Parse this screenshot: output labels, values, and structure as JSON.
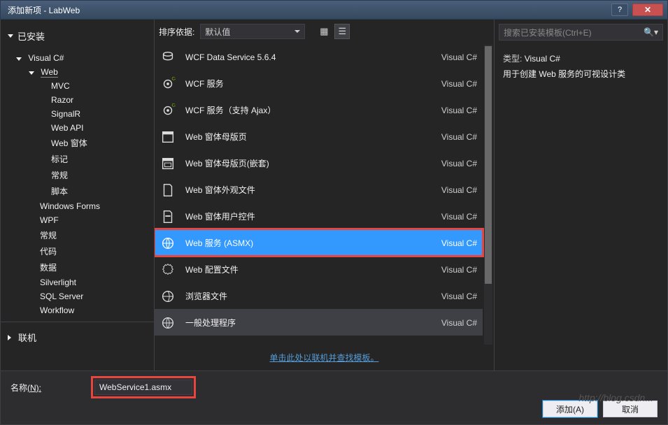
{
  "window": {
    "title": "添加新项 - LabWeb"
  },
  "sidebar": {
    "installed": "已安装",
    "online": "联机",
    "nodes": [
      {
        "label": "Visual C#",
        "level": 1,
        "expanded": true
      },
      {
        "label": "Web",
        "level": 2,
        "expanded": true,
        "selected": true
      },
      {
        "label": "MVC",
        "level": 3
      },
      {
        "label": "Razor",
        "level": 3
      },
      {
        "label": "SignalR",
        "level": 3
      },
      {
        "label": "Web API",
        "level": 3
      },
      {
        "label": "Web 窗体",
        "level": 3
      },
      {
        "label": "标记",
        "level": 3
      },
      {
        "label": "常规",
        "level": 3
      },
      {
        "label": "脚本",
        "level": 3
      },
      {
        "label": "Windows Forms",
        "level": "2b"
      },
      {
        "label": "WPF",
        "level": "2b"
      },
      {
        "label": "常规",
        "level": "2b"
      },
      {
        "label": "代码",
        "level": "2b"
      },
      {
        "label": "数据",
        "level": "2b"
      },
      {
        "label": "Silverlight",
        "level": "2b"
      },
      {
        "label": "SQL Server",
        "level": "2b"
      },
      {
        "label": "Workflow",
        "level": "2b"
      }
    ]
  },
  "toolbar": {
    "sort_label": "排序依据:",
    "sort_value": "默认值"
  },
  "search": {
    "placeholder": "搜索已安装模板(Ctrl+E)"
  },
  "items": [
    {
      "name": "WCF Data Service 5.6.4",
      "lang": "Visual C#"
    },
    {
      "name": "WCF 服务",
      "lang": "Visual C#"
    },
    {
      "name": "WCF 服务（支持 Ajax）",
      "lang": "Visual C#"
    },
    {
      "name": "Web 窗体母版页",
      "lang": "Visual C#"
    },
    {
      "name": "Web 窗体母版页(嵌套)",
      "lang": "Visual C#"
    },
    {
      "name": "Web 窗体外观文件",
      "lang": "Visual C#"
    },
    {
      "name": "Web 窗体用户控件",
      "lang": "Visual C#"
    },
    {
      "name": "Web 服务 (ASMX)",
      "lang": "Visual C#",
      "selected": true
    },
    {
      "name": "Web 配置文件",
      "lang": "Visual C#"
    },
    {
      "name": "浏览器文件",
      "lang": "Visual C#"
    },
    {
      "name": "一般处理程序",
      "lang": "Visual C#"
    }
  ],
  "info": {
    "type_label": "类型:",
    "type_value": "Visual C#",
    "description": "用于创建 Web 服务的可视设计类"
  },
  "online_link": "单击此处以联机并查找模板。",
  "bottom": {
    "name_label": "名称",
    "name_suffix": "(N):",
    "name_value": "WebService1.asmx",
    "add_label": "添加(A)",
    "cancel_label": "取消"
  },
  "watermark": "http://blog.csdn..."
}
